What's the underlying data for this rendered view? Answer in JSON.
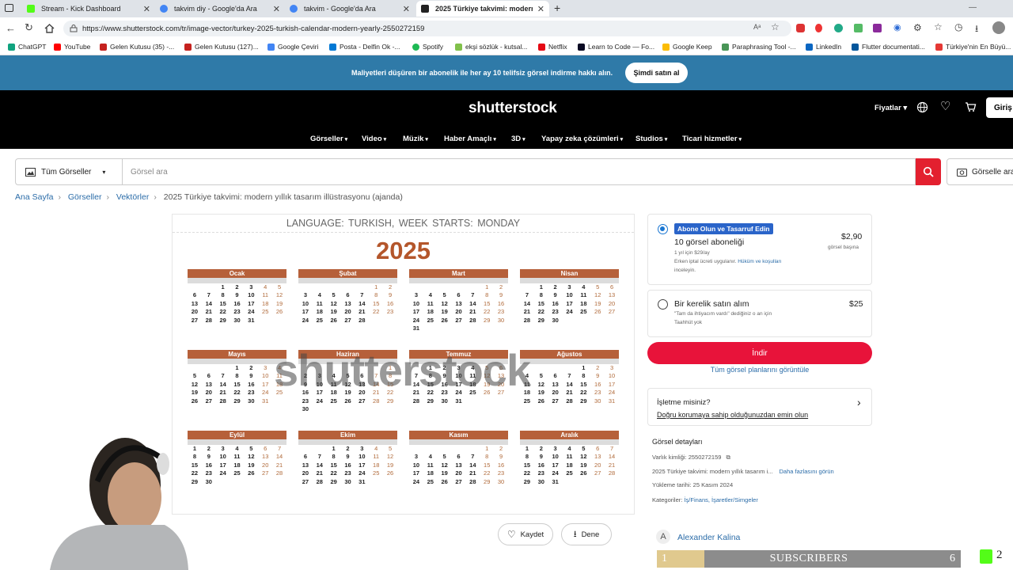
{
  "tabs": [
    {
      "title": "Stream - Kick Dashboard",
      "color": "#53fc18"
    },
    {
      "title": "takvim diy - Google'da Ara",
      "color": "#4285f4"
    },
    {
      "title": "takvim - Google'da Ara",
      "color": "#4285f4"
    },
    {
      "title": "2025 Türkiye takvimi: modern yıllı",
      "color": "#222222"
    }
  ],
  "url": "https://www.shutterstock.com/tr/image-vector/turkey-2025-turkish-calendar-modern-yearly-2550272159",
  "bookmarks": [
    {
      "label": "ChatGPT",
      "color": "#10a37f"
    },
    {
      "label": "YouTube",
      "color": "#ff0000"
    },
    {
      "label": "Gelen Kutusu (35) -...",
      "color": "#c5221f"
    },
    {
      "label": "Gelen Kutusu (127)...",
      "color": "#c5221f"
    },
    {
      "label": "Google Çeviri",
      "color": "#4285f4"
    },
    {
      "label": "Posta - Delfin Ok -...",
      "color": "#0078d4"
    },
    {
      "label": "Spotify",
      "color": "#1db954"
    },
    {
      "label": "ekşi sözlük - kutsal...",
      "color": "#81c14b"
    },
    {
      "label": "Netflix",
      "color": "#e50914"
    },
    {
      "label": "Learn to Code — Fo...",
      "color": "#0a0a23"
    },
    {
      "label": "Google Keep",
      "color": "#fbbc04"
    },
    {
      "label": "Paraphrasing Tool -...",
      "color": "#499557"
    },
    {
      "label": "LinkedIn",
      "color": "#0a66c2"
    },
    {
      "label": "Flutter documentati...",
      "color": "#02569b"
    },
    {
      "label": "Türkiye'nin En Büyü...",
      "color": "#e53935"
    }
  ],
  "promo": {
    "text": "Maliyetleri düşüren bir abonelik ile her ay 10 telifsiz görsel indirme hakkı alın.",
    "button": "Şimdi satın al"
  },
  "header": {
    "logo": "shutterstock",
    "nav": [
      "Görseller",
      "Video",
      "Müzik",
      "Haber Amaçlı",
      "3D",
      "Yapay zeka çözümleri",
      "Studios",
      "Ticari hizmetler"
    ],
    "plans": "Fiyatlar",
    "login": "Giriş"
  },
  "search": {
    "category": "Tüm Görseller",
    "placeholder": "Görsel ara",
    "image_search": "Görselle ara"
  },
  "breadcrumb": [
    "Ana Sayfa",
    "Görseller",
    "Vektörler",
    "2025 Türkiye takvimi: modern yıllık tasarım illüstrasyonu (ajanda)"
  ],
  "preview": {
    "language_line": "LANGUAGE: TURKISH,    WEEK STARTS: MONDAY",
    "year": "2025",
    "watermark": "shutterstock",
    "months": [
      {
        "name": "Ocak",
        "offset": 2,
        "days": 31
      },
      {
        "name": "Şubat",
        "offset": 5,
        "days": 28
      },
      {
        "name": "Mart",
        "offset": 5,
        "days": 31
      },
      {
        "name": "Nisan",
        "offset": 1,
        "days": 30
      },
      {
        "name": "Mayıs",
        "offset": 3,
        "days": 31
      },
      {
        "name": "Haziran",
        "offset": 6,
        "days": 30
      },
      {
        "name": "Temmuz",
        "offset": 1,
        "days": 31
      },
      {
        "name": "Ağustos",
        "offset": 4,
        "days": 31
      },
      {
        "name": "Eylül",
        "offset": 0,
        "days": 30
      },
      {
        "name": "Ekim",
        "offset": 2,
        "days": 31
      },
      {
        "name": "Kasım",
        "offset": 5,
        "days": 30
      },
      {
        "name": "Aralık",
        "offset": 0,
        "days": 31
      }
    ],
    "save": "Kaydet",
    "try": "Dene"
  },
  "purchase": {
    "sub_badge": "Abone Olun ve Tasarruf Edin",
    "sub_title": "10 görsel aboneliği",
    "sub_price": "$2,90",
    "sub_per": "görsel başına",
    "sub_year": "1 yıl için $29/ay",
    "sub_cancel": "Erken iptal ücreti uygulanır.",
    "sub_terms": "Hüküm ve koşulları",
    "sub_review": "inceleyin.",
    "once_title": "Bir kerelik satın alım",
    "once_price": "$25",
    "once_desc1": "\"Tam da ihtiyacım vardı\" dediğiniz o an için",
    "once_desc2": "Taahhüt yok",
    "download": "İndir",
    "all_plans": "Tüm görsel planlarını görüntüle",
    "business_q": "İşletme misiniz?",
    "business_link": "Doğru korumaya sahip olduğunuzdan emin olun"
  },
  "details": {
    "heading": "Görsel detayları",
    "asset_id": "Varlık kimliği: 2550272159",
    "title": "2025 Türkiye takvimi: modern yıllık tasarım i...",
    "more": "Daha fazlasını görün",
    "upload": "Yükleme tarihi: 25 Kasım 2024",
    "categories_label": "Kategoriler:",
    "categories": "İş/Finans, İşaretler/Simgeler",
    "avatar_letter": "A",
    "author": "Alexander Kalina"
  },
  "overlay": {
    "subs_label": "SUBSCRIBERS",
    "subs_left": "1",
    "subs_right": "6",
    "kick_count": "2"
  }
}
